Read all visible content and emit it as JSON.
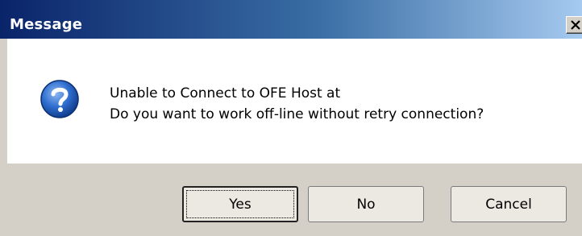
{
  "window": {
    "title": "Message",
    "close_symbol": "×"
  },
  "message": {
    "line1": "Unable to Connect to OFE Host at",
    "line2": "Do you want to work off-line without retry connection?",
    "icon": "question-icon"
  },
  "buttons": {
    "yes": "Yes",
    "no": "No",
    "cancel": "Cancel"
  },
  "colors": {
    "titlebar_start": "#0a246a",
    "titlebar_end": "#a6caf0",
    "icon_blue": "#1f5fbf",
    "dialog_bg": "#d4d0c8"
  }
}
